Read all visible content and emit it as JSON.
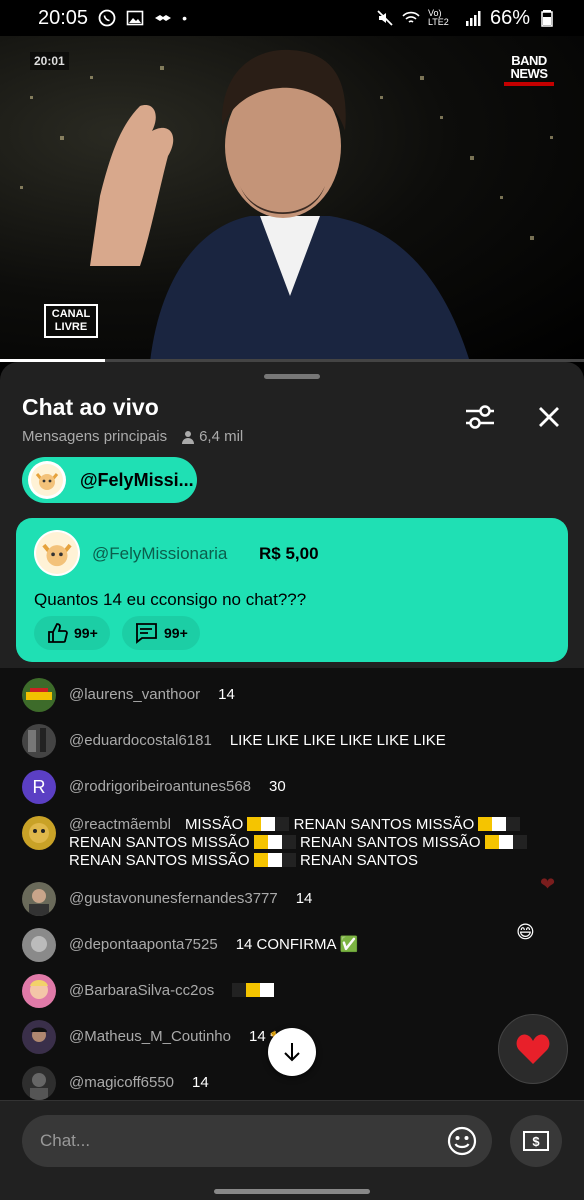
{
  "status_bar": {
    "time": "20:05",
    "network": "Vo) LTE2",
    "battery": "66%"
  },
  "video": {
    "timestamp": "20:01",
    "channel_logo_line1": "BAND",
    "channel_logo_line2": "NEWS",
    "program_logo_line1": "CANAL",
    "program_logo_line2": "LIVRE",
    "progress": 0.18
  },
  "chat_header": {
    "title": "Chat ao vivo",
    "mode": "Mensagens principais",
    "viewers": "6,4 mil"
  },
  "pinned_chip": {
    "label": "@FelyMissi..."
  },
  "super_chat": {
    "author": "@FelyMissionaria",
    "amount": "R$ 5,00",
    "message": "Quantos 14 eu cconsigo no chat???",
    "likes": "99+",
    "replies": "99+"
  },
  "messages": [
    {
      "author": "@laurens_vanthoor",
      "text": "14",
      "avatar_color": "#3d6b2a"
    },
    {
      "author": "@eduardocostal6181",
      "text": "LIKE LIKE LIKE LIKE LIKE LIKE",
      "avatar_color": "#444444"
    },
    {
      "author": "@rodrigoribeiroantunes568",
      "text": "30",
      "avatar_letter": "R",
      "avatar_color": "#5b3fc4"
    },
    {
      "author": "@reactmãembl",
      "line1": "MISSÃO",
      "line1b": "RENAN SANTOS MISSÃO",
      "line2a": "RENAN SANTOS MISSÃO",
      "line2b": "RENAN SANTOS MISSÃO",
      "line3a": "RENAN SANTOS MISSÃO",
      "line3b": "RENAN SANTOS",
      "avatar_color": "#c9a227"
    },
    {
      "author": "@gustavonunesfernandes3777",
      "text": "14",
      "avatar_color": "#6a6a5a"
    },
    {
      "author": "@depontaaponta7525",
      "text": "14 CONFIRMA ✅",
      "avatar_color": "#8a8a8a"
    },
    {
      "author": "@BarbaraSilva-cc2os",
      "text": "",
      "avatar_color": "#e07aa8"
    },
    {
      "author": "@Matheus_M_Coutinho",
      "text": "14 🐆🐆",
      "avatar_color": "#3a2f4a"
    },
    {
      "author": "@magicoff6550",
      "text": "14",
      "avatar_color": "#2e2e2e"
    }
  ],
  "input": {
    "placeholder": "Chat..."
  },
  "colors": {
    "accent": "#1fe0b4",
    "panel": "#212121",
    "chat_bg": "#0f0f0f"
  },
  "icons": [
    "whatsapp-icon",
    "gallery-icon",
    "tune-icon",
    "close-icon",
    "person-icon",
    "like-icon",
    "reply-icon",
    "emoji-icon",
    "super-chat-icon",
    "arrow-down-icon",
    "heart-icon"
  ]
}
